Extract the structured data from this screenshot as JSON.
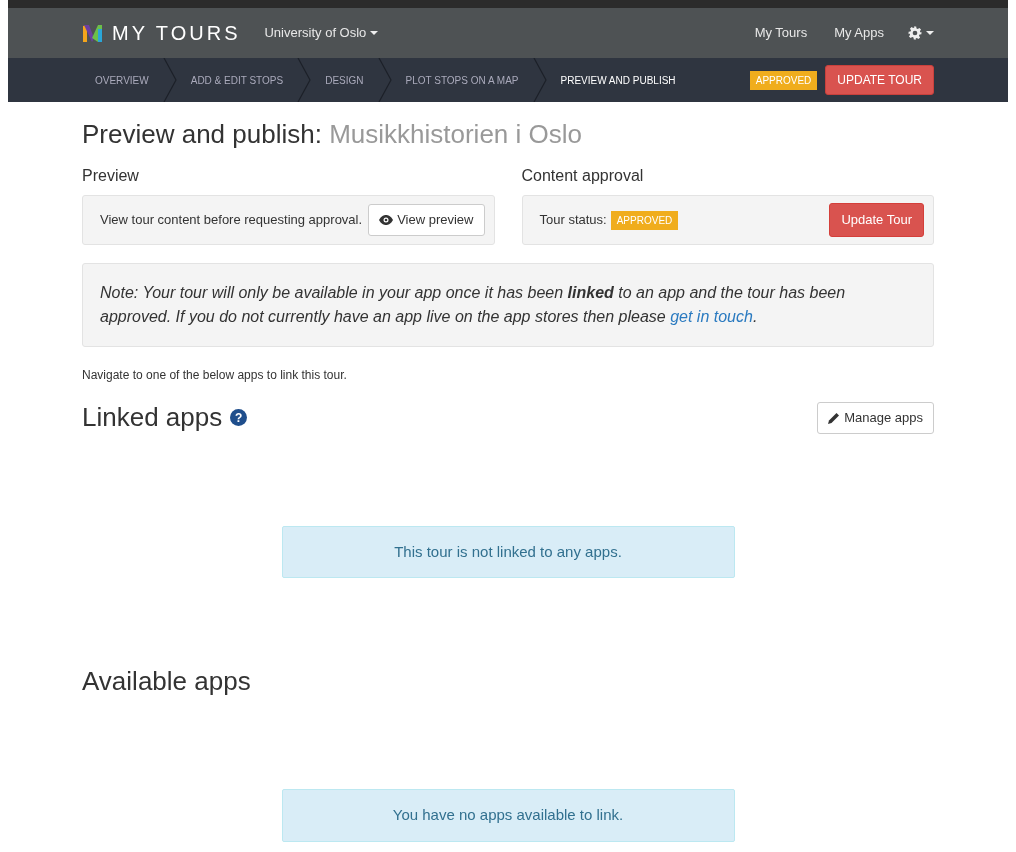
{
  "navbar": {
    "brand": "MY TOURS",
    "org": "University of Oslo",
    "links": [
      "My Tours",
      "My Apps"
    ]
  },
  "steps": [
    {
      "label": "OVERVIEW",
      "selected": false
    },
    {
      "label": "ADD & EDIT STOPS",
      "selected": false
    },
    {
      "label": "DESIGN",
      "selected": false
    },
    {
      "label": "PLOT STOPS ON A MAP",
      "selected": false
    },
    {
      "label": "PREVIEW AND PUBLISH",
      "selected": true
    }
  ],
  "step_status": "APPROVED",
  "step_button": "UPDATE TOUR",
  "page_title": {
    "prefix": "Preview and publish:",
    "tour": "Musikkhistorien i Oslo"
  },
  "preview": {
    "heading": "Preview",
    "text": "View tour content before requesting approval.",
    "button": "View preview"
  },
  "approval": {
    "heading": "Content approval",
    "label": "Tour status:",
    "status": "APPROVED",
    "button": "Update Tour"
  },
  "note": {
    "before": "Note: Your tour will only be available in your app once it has been **linked** to an app and the tour has been approved. If you do not currently have an app live on the app stores then please",
    "link": "get in touch",
    "after": "."
  },
  "hint": "Navigate to one of the below apps to link this tour.",
  "linked": {
    "heading": "Linked apps",
    "help": "?",
    "button": "Manage apps",
    "empty": "This tour is not linked to any apps."
  },
  "available": {
    "heading": "Available apps",
    "empty": "You have no apps available to link."
  }
}
